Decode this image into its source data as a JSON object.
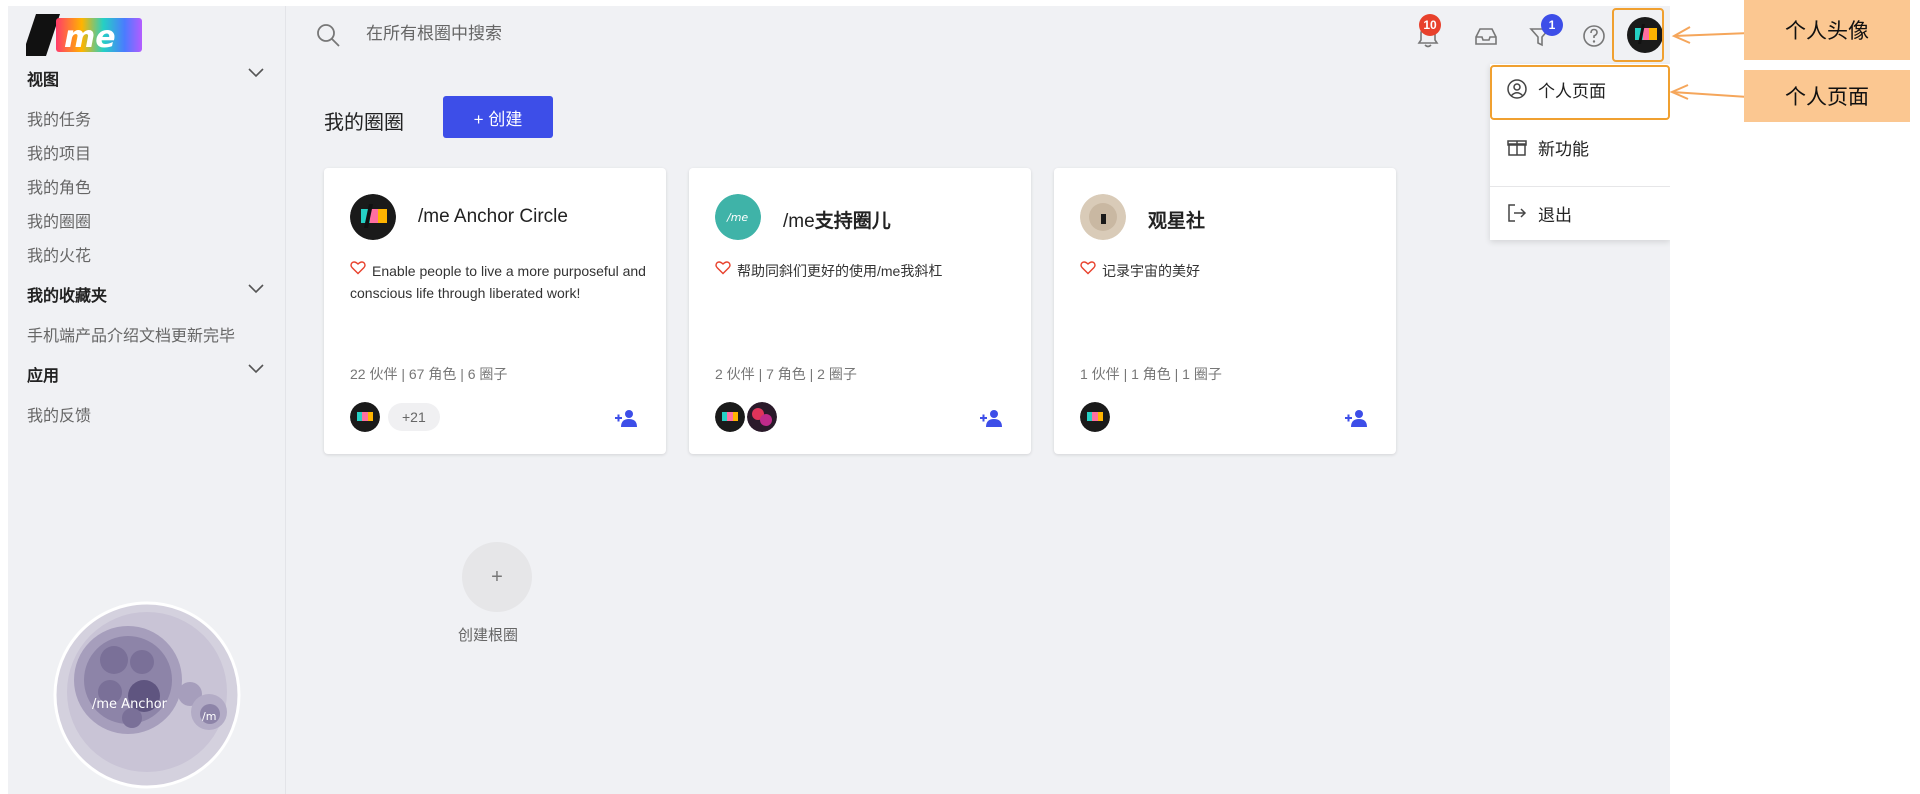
{
  "sidebar": {
    "logo_text": "/me",
    "sections": [
      {
        "label": "视图",
        "items": [
          "我的任务",
          "我的项目",
          "我的角色",
          "我的圈圈",
          "我的火花"
        ]
      },
      {
        "label": "我的收藏夹",
        "items": [
          "手机端产品介绍文档更新完毕"
        ]
      },
      {
        "label": "应用",
        "items": [
          "我的反馈"
        ]
      }
    ],
    "bubble_labels": [
      "/me Anchor",
      "/m"
    ]
  },
  "topbar": {
    "search_placeholder": "在所有根圈中搜索",
    "notifications_count": "10",
    "filter_count": "1",
    "icons": [
      "bell-icon",
      "inbox-icon",
      "filter-icon",
      "help-icon",
      "user-avatar"
    ],
    "colors": {
      "notif_badge": "#e8412c",
      "filter_badge": "#3d4ee8"
    }
  },
  "main": {
    "title": "我的圈圈",
    "create_label": "+ 创建",
    "create_root_label": "创建根圈",
    "create_root_symbol": "+",
    "accent": "#3d4ee8"
  },
  "cards": [
    {
      "name_prefix": "/me Anchor Circle",
      "name_bold": "",
      "description": "Enable people to live a more purposeful and conscious life through liberated work!",
      "stats": "22 伙伴 | 67 角色 | 6 圈子",
      "more": "+21"
    },
    {
      "name_prefix": "/me",
      "name_bold": "支持圈儿",
      "description": "帮助同斜们更好的使用/me我斜杠",
      "stats": "2 伙伴 | 7 角色 | 2 圈子",
      "more": ""
    },
    {
      "name_prefix": "",
      "name_bold": "观星社",
      "description": "记录宇宙的美好",
      "stats": "1 伙伴 | 1 角色 | 1 圈子",
      "more": ""
    }
  ],
  "dropdown": {
    "items": [
      "个人页面",
      "新功能",
      "退出"
    ]
  },
  "annotations": {
    "avatar_label": "个人头像",
    "profile_label": "个人页面"
  }
}
